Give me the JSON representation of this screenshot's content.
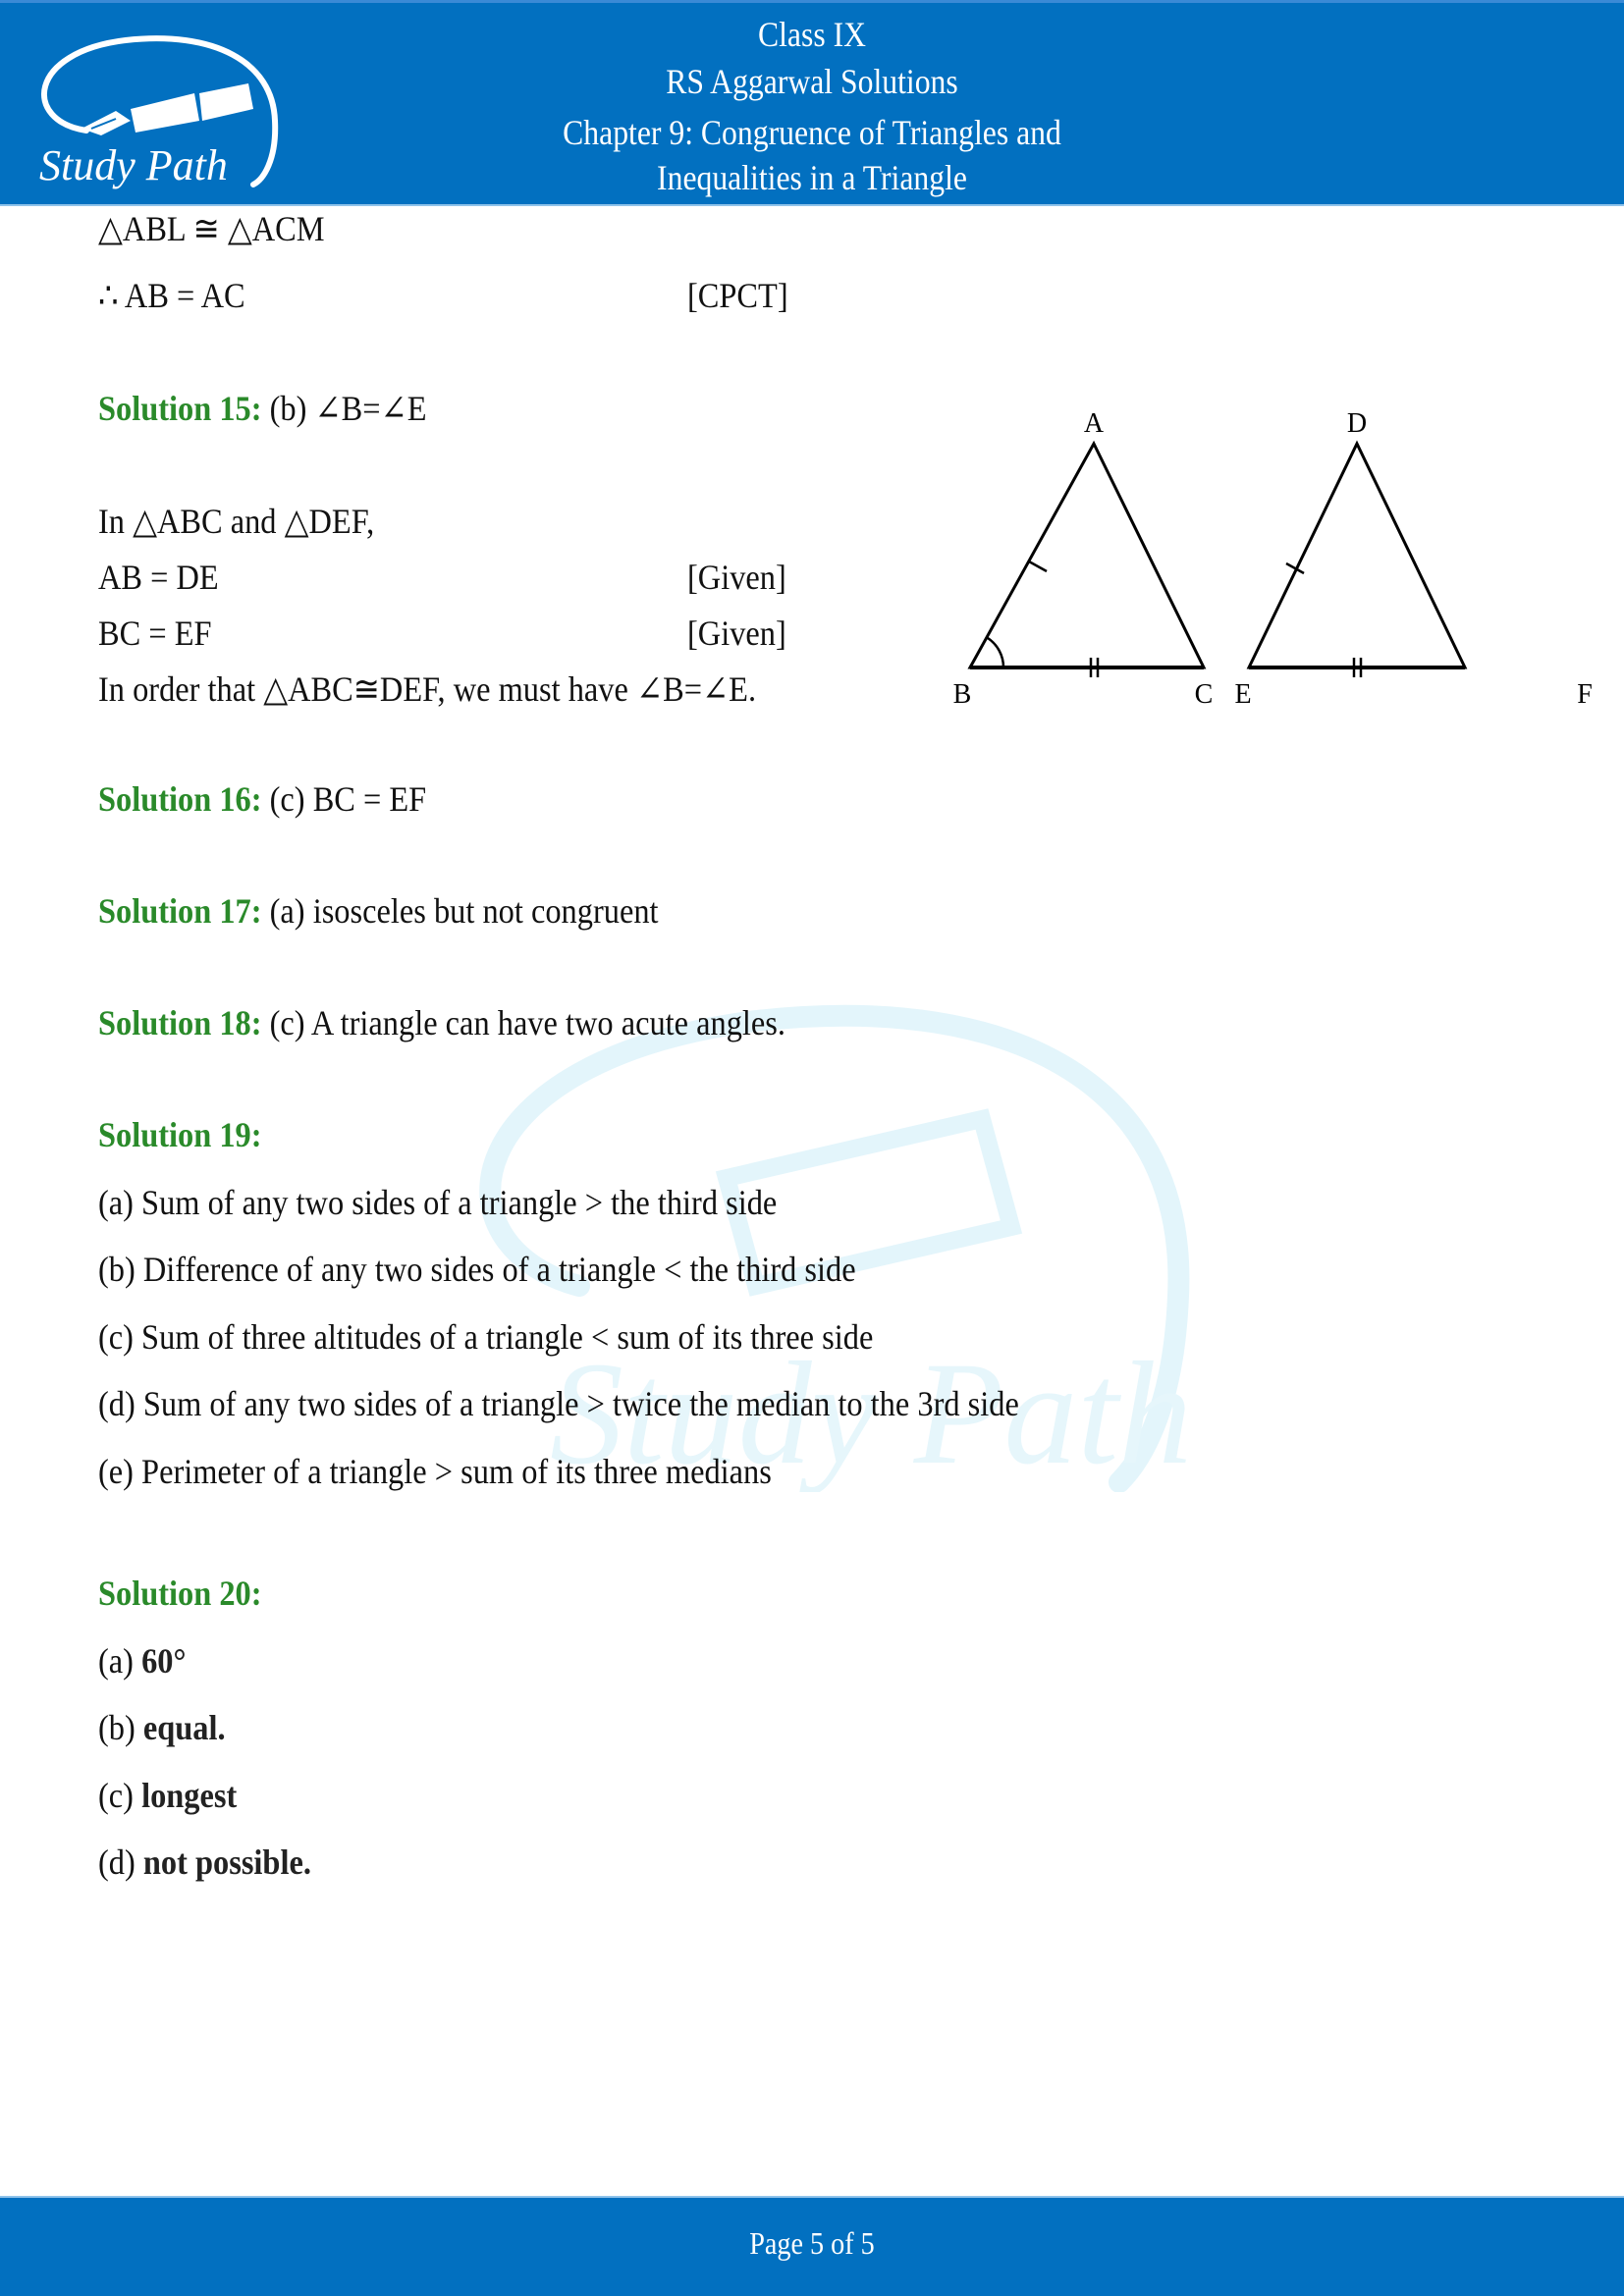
{
  "header": {
    "logo_text": "Study Path",
    "line1": "Class IX",
    "line2": "RS Aggarwal Solutions",
    "line3": "Chapter 9: Congruence of Triangles and",
    "line4": "Inequalities in a Triangle",
    "brand_color": "#0270c0"
  },
  "content": {
    "top_lines": [
      {
        "text": "△ABL ≅ △ACM",
        "reason": ""
      },
      {
        "text": "∴ AB = AC",
        "reason": "[CPCT]"
      }
    ],
    "solution15": {
      "label": "Solution 15:",
      "answer": " (b) ∠B=∠E",
      "lines": [
        {
          "text": "In △ABC and △DEF,",
          "reason": ""
        },
        {
          "text": "AB = DE",
          "reason": "[Given]"
        },
        {
          "text": "BC = EF",
          "reason": "[Given]"
        },
        {
          "text": "In order that △ABC≅DEF, we must have ∠B=∠E.",
          "reason": ""
        }
      ],
      "diagram": {
        "triangle1": {
          "top": "A",
          "left": "B",
          "right": "C"
        },
        "triangle2": {
          "top": "D",
          "left": "E",
          "right": "F"
        }
      }
    },
    "solution16": {
      "label": "Solution 16:",
      "answer": " (c) BC = EF"
    },
    "solution17": {
      "label": "Solution 17:",
      "answer": " (a) isosceles but not congruent"
    },
    "solution18": {
      "label": "Solution 18:",
      "answer": " (c) A triangle can have two acute angles."
    },
    "solution19": {
      "label": "Solution 19:",
      "items": [
        "(a) Sum of any two sides of a triangle > the third side",
        "(b) Difference of any two sides of a triangle < the third side",
        "(c) Sum of three altitudes of a triangle < sum of its three side",
        "(d) Sum of any two sides of a triangle > twice the median to the 3rd side",
        "(e) Perimeter of a triangle > sum of its three medians"
      ]
    },
    "solution20": {
      "label": "Solution 20:",
      "items": [
        {
          "prefix": "(a) ",
          "answer": "60°"
        },
        {
          "prefix": "(b) ",
          "answer": "equal."
        },
        {
          "prefix": "(c) ",
          "answer": "longest"
        },
        {
          "prefix": "(d) ",
          "answer": "not possible."
        }
      ]
    },
    "label_color": "#2a8a2a"
  },
  "footer": {
    "page_text": "Page 5 of 5"
  }
}
